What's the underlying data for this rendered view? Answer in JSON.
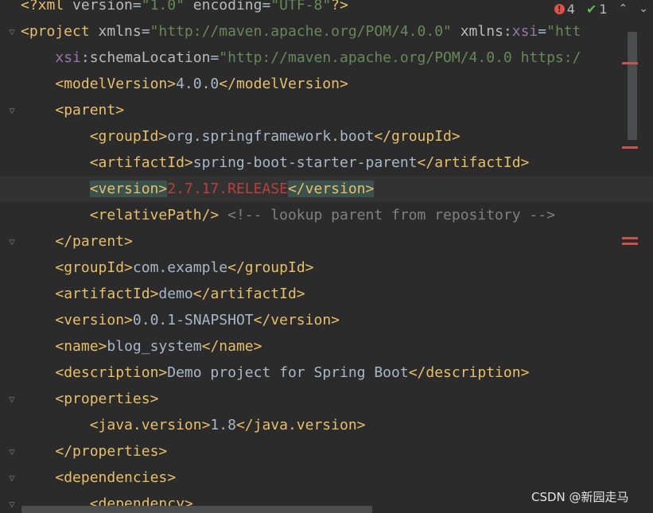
{
  "editor": {
    "lines": [
      {
        "id": "xml-decl",
        "tokens": [
          {
            "t": "<?xml ",
            "c": "tag"
          },
          {
            "t": "version",
            "c": "attr"
          },
          {
            "t": "=",
            "c": "text"
          },
          {
            "t": "\"1.0\"",
            "c": "val"
          },
          {
            "t": " ",
            "c": "text"
          },
          {
            "t": "encoding",
            "c": "attr"
          },
          {
            "t": "=",
            "c": "text"
          },
          {
            "t": "\"UTF-8\"",
            "c": "val"
          },
          {
            "t": "?>",
            "c": "tag"
          }
        ]
      },
      {
        "id": "project-open",
        "tokens": [
          {
            "t": "<project ",
            "c": "tag"
          },
          {
            "t": "xmlns",
            "c": "attr"
          },
          {
            "t": "=",
            "c": "text"
          },
          {
            "t": "\"http://maven.apache.org/POM/4.0.0\"",
            "c": "val"
          },
          {
            "t": " ",
            "c": "text"
          },
          {
            "t": "xmlns",
            "c": "attr"
          },
          {
            "t": ":",
            "c": "text"
          },
          {
            "t": "xsi",
            "c": "ns"
          },
          {
            "t": "=",
            "c": "text"
          },
          {
            "t": "\"htt",
            "c": "val"
          }
        ]
      },
      {
        "id": "schema-location",
        "tokens": [
          {
            "t": "    ",
            "c": "text"
          },
          {
            "t": "xsi",
            "c": "ns"
          },
          {
            "t": ":",
            "c": "text"
          },
          {
            "t": "schemaLocation",
            "c": "attr"
          },
          {
            "t": "=",
            "c": "text"
          },
          {
            "t": "\"http://maven.apache.org/POM/4.0.0 https:/",
            "c": "val"
          }
        ]
      },
      {
        "id": "model-version",
        "tokens": [
          {
            "t": "    ",
            "c": "text"
          },
          {
            "t": "<modelVersion>",
            "c": "tag"
          },
          {
            "t": "4.0.0",
            "c": "text"
          },
          {
            "t": "</modelVersion>",
            "c": "tag"
          }
        ]
      },
      {
        "id": "parent-open",
        "tokens": [
          {
            "t": "    ",
            "c": "text"
          },
          {
            "t": "<parent>",
            "c": "tag"
          }
        ]
      },
      {
        "id": "parent-group",
        "tokens": [
          {
            "t": "        ",
            "c": "text"
          },
          {
            "t": "<groupId>",
            "c": "tag"
          },
          {
            "t": "org.springframework.boot",
            "c": "text"
          },
          {
            "t": "</groupId>",
            "c": "tag"
          }
        ]
      },
      {
        "id": "parent-artifact",
        "tokens": [
          {
            "t": "        ",
            "c": "text"
          },
          {
            "t": "<artifactId>",
            "c": "tag"
          },
          {
            "t": "spring-boot-starter-parent",
            "c": "text"
          },
          {
            "t": "</artifactId>",
            "c": "tag"
          }
        ]
      },
      {
        "id": "parent-version",
        "current": true,
        "tokens": [
          {
            "t": "        ",
            "c": "text"
          },
          {
            "t": "<version>",
            "c": "tag",
            "hl": true
          },
          {
            "t": "2.7.17.RELEASE",
            "c": "err"
          },
          {
            "t": "</version>",
            "c": "tag",
            "hl": true
          }
        ]
      },
      {
        "id": "relative-path",
        "tokens": [
          {
            "t": "        ",
            "c": "text"
          },
          {
            "t": "<relativePath/>",
            "c": "tag"
          },
          {
            "t": " ",
            "c": "text"
          },
          {
            "t": "<!-- lookup parent from repository -->",
            "c": "cmt"
          }
        ]
      },
      {
        "id": "parent-close",
        "tokens": [
          {
            "t": "    ",
            "c": "text"
          },
          {
            "t": "</parent>",
            "c": "tag"
          }
        ]
      },
      {
        "id": "group-id",
        "tokens": [
          {
            "t": "    ",
            "c": "text"
          },
          {
            "t": "<groupId>",
            "c": "tag"
          },
          {
            "t": "com.example",
            "c": "text"
          },
          {
            "t": "</groupId>",
            "c": "tag"
          }
        ]
      },
      {
        "id": "artifact-id",
        "tokens": [
          {
            "t": "    ",
            "c": "text"
          },
          {
            "t": "<artifactId>",
            "c": "tag"
          },
          {
            "t": "demo",
            "c": "text"
          },
          {
            "t": "</artifactId>",
            "c": "tag"
          }
        ]
      },
      {
        "id": "version",
        "tokens": [
          {
            "t": "    ",
            "c": "text"
          },
          {
            "t": "<version>",
            "c": "tag"
          },
          {
            "t": "0.0.1-SNAPSHOT",
            "c": "text"
          },
          {
            "t": "</version>",
            "c": "tag"
          }
        ]
      },
      {
        "id": "name",
        "tokens": [
          {
            "t": "    ",
            "c": "text"
          },
          {
            "t": "<name>",
            "c": "tag"
          },
          {
            "t": "blog_system",
            "c": "text"
          },
          {
            "t": "</name>",
            "c": "tag"
          }
        ]
      },
      {
        "id": "description",
        "tokens": [
          {
            "t": "    ",
            "c": "text"
          },
          {
            "t": "<description>",
            "c": "tag"
          },
          {
            "t": "Demo project for Spring Boot",
            "c": "text"
          },
          {
            "t": "</description>",
            "c": "tag"
          }
        ]
      },
      {
        "id": "properties-open",
        "tokens": [
          {
            "t": "    ",
            "c": "text"
          },
          {
            "t": "<properties>",
            "c": "tag"
          }
        ]
      },
      {
        "id": "java-version",
        "tokens": [
          {
            "t": "        ",
            "c": "text"
          },
          {
            "t": "<java.version>",
            "c": "tag"
          },
          {
            "t": "1.8",
            "c": "text"
          },
          {
            "t": "</java.version>",
            "c": "tag"
          }
        ]
      },
      {
        "id": "properties-close",
        "tokens": [
          {
            "t": "    ",
            "c": "text"
          },
          {
            "t": "</properties>",
            "c": "tag"
          }
        ]
      },
      {
        "id": "dependencies-open",
        "tokens": [
          {
            "t": "    ",
            "c": "text"
          },
          {
            "t": "<dependencies>",
            "c": "tag"
          }
        ]
      },
      {
        "id": "dependency-open",
        "tokens": [
          {
            "t": "        ",
            "c": "text"
          },
          {
            "t": "<dependency>",
            "c": "tag"
          }
        ]
      }
    ]
  },
  "inspections": {
    "error_count": "4",
    "error_glyph": "!",
    "ok_count": "1",
    "ok_glyph": "✔",
    "prev_glyph": "⌃",
    "next_glyph": "⌄"
  },
  "fold_glyph": "▽",
  "watermark": "CSDN @新园走马",
  "colors": {
    "background": "#2b2b2b",
    "tag": "#e8bf6a",
    "attribute": "#bababa",
    "namespace": "#9876aa",
    "string": "#6a8759",
    "text": "#a9b7c6",
    "error": "#bc3f3c",
    "comment": "#808080",
    "match_highlight": "#3b514d"
  }
}
